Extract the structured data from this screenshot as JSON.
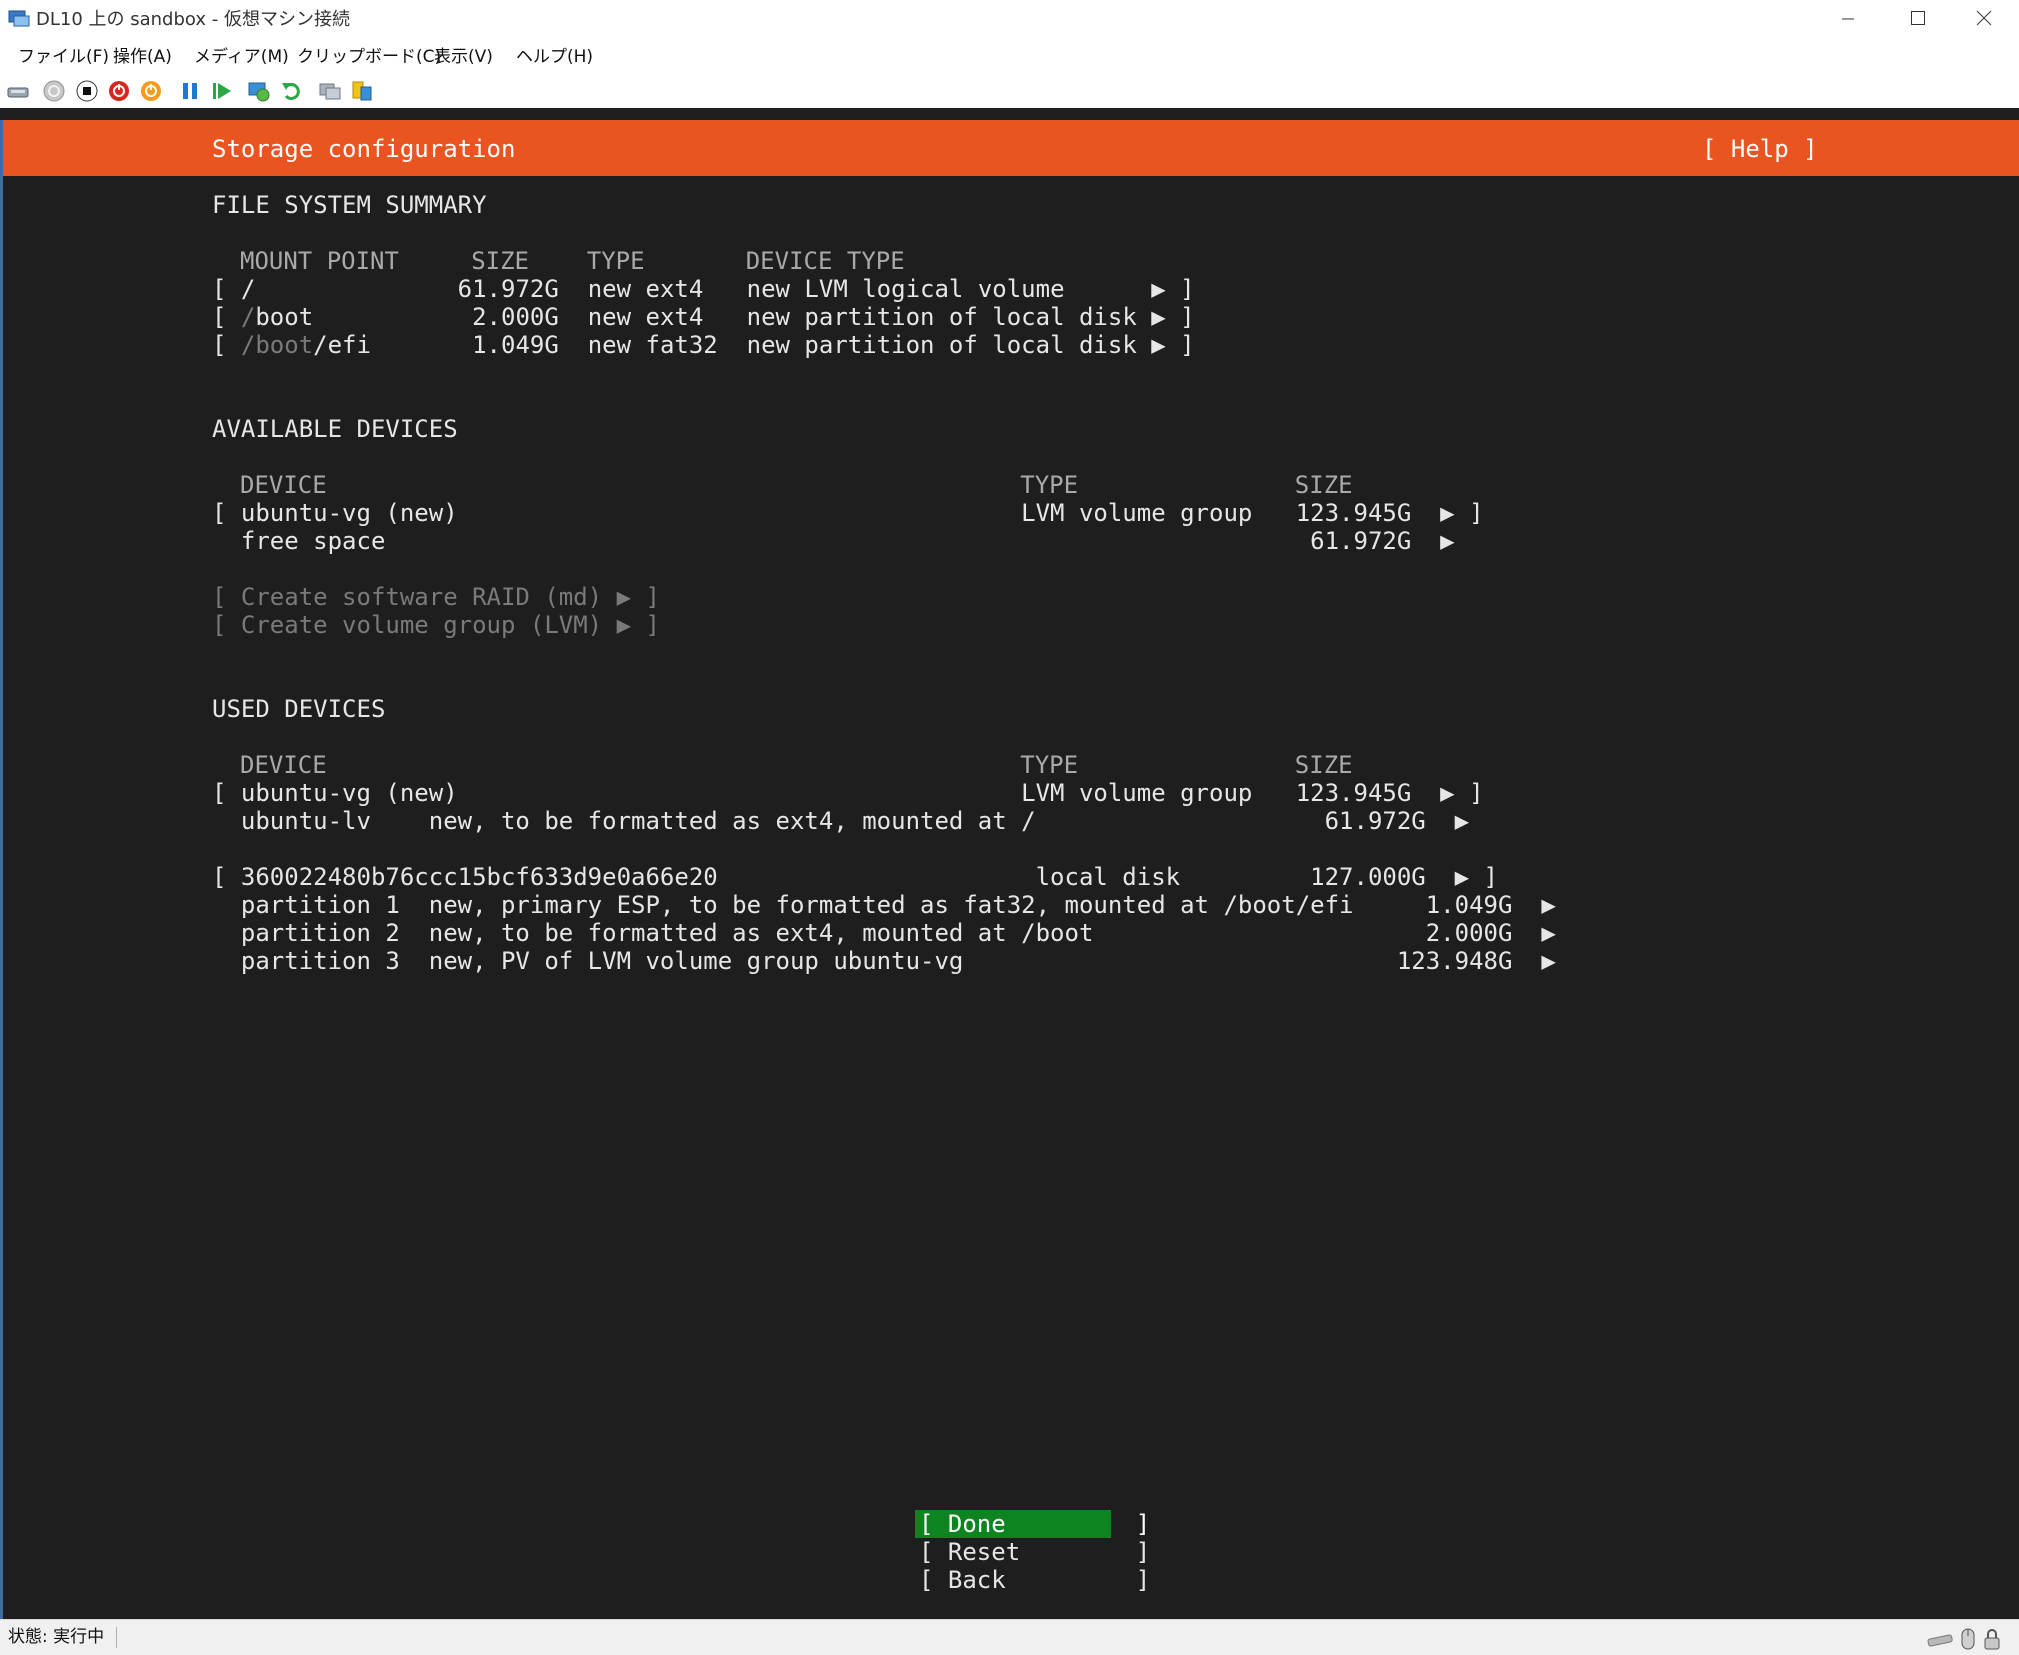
{
  "window": {
    "title": "DL10 上の sandbox - 仮想マシン接続",
    "icons": [
      "vm-connect-icon",
      "minimize-icon",
      "maximize-icon",
      "close-icon"
    ]
  },
  "menubar": {
    "items": [
      "ファイル(F)",
      "操作(A)",
      "メディア(M)",
      "クリップボード(C)",
      "表示(V)",
      "ヘルプ(H)"
    ]
  },
  "toolbar": {
    "icons": [
      "ctrl-alt-del-icon",
      "start-icon",
      "turn-off-icon",
      "shutdown-icon",
      "save-icon",
      "pause-icon",
      "resume-icon",
      "checkpoint-icon",
      "revert-icon",
      "enhanced-session-icon",
      "share-icon"
    ]
  },
  "installer": {
    "header_title": "Storage configuration",
    "help_label": "[ Help ]",
    "colors": {
      "header_bg": "#e95420",
      "done_bg": "#0e8420",
      "terminal_bg": "#1e1e1e"
    },
    "fs_summary": {
      "heading": "FILE SYSTEM SUMMARY",
      "columns_line": "MOUNT POINT     SIZE    TYPE       DEVICE TYPE",
      "rows": [
        {
          "open": "[ ",
          "mount_dim": "",
          "mount": "/",
          "rest": "              61.972G  new ext4   new LVM logical volume      ▶ ]"
        },
        {
          "open": "[ ",
          "mount_dim": "/",
          "mount": "boot",
          "rest": "           2.000G  new ext4   new partition of local disk ▶ ]"
        },
        {
          "open": "[ ",
          "mount_dim": "/boot",
          "mount": "/efi",
          "rest": "       1.049G  new fat32  new partition of local disk ▶ ]"
        }
      ]
    },
    "available": {
      "heading": "AVAILABLE DEVICES",
      "columns_line": "DEVICE                                                TYPE               SIZE",
      "rows": [
        "[ ubuntu-vg (new)                                       LVM volume group   123.945G  ▶ ]",
        "  free space                                                                61.972G  ▶"
      ],
      "actions": [
        "[ Create software RAID (md) ▶ ]",
        "[ Create volume group (LVM) ▶ ]"
      ]
    },
    "used": {
      "heading": "USED DEVICES",
      "columns_line": "DEVICE                                                TYPE               SIZE",
      "rows": [
        "[ ubuntu-vg (new)                                       LVM volume group   123.945G  ▶ ]",
        "  ubuntu-lv    new, to be formatted as ext4, mounted at /                    61.972G  ▶",
        "[ 360022480b76ccc15bcf633d9e0a66e20                      local disk         127.000G  ▶ ]",
        "  partition 1  new, primary ESP, to be formatted as fat32, mounted at /boot/efi     1.049G  ▶",
        "  partition 2  new, to be formatted as ext4, mounted at /boot                       2.000G  ▶",
        "  partition 3  new, PV of LVM volume group ubuntu-vg                              123.948G  ▶"
      ]
    },
    "buttons": {
      "done": "[ Done         ]",
      "reset": "[ Reset        ]",
      "back": "[ Back         ]"
    }
  },
  "statusbar": {
    "status": "状態: 実行中",
    "tray_icons": [
      "keyboard-icon",
      "mouse-icon",
      "lock-icon"
    ]
  }
}
